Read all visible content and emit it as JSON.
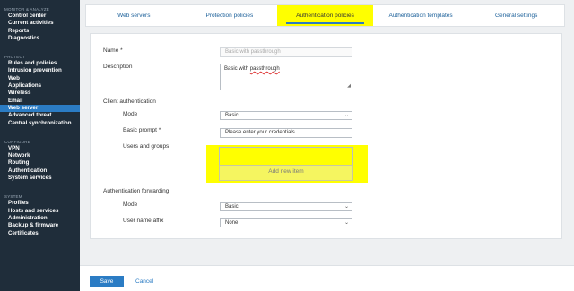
{
  "sidebar": {
    "sections": [
      {
        "title": "MONITOR & ANALYZE",
        "items": [
          "Control center",
          "Current activities",
          "Reports",
          "Diagnostics"
        ]
      },
      {
        "title": "PROTECT",
        "items": [
          "Rules and policies",
          "Intrusion prevention",
          "Web",
          "Applications",
          "Wireless",
          "Email",
          "Web server",
          "Advanced threat",
          "Central synchronization"
        ]
      },
      {
        "title": "CONFIGURE",
        "items": [
          "VPN",
          "Network",
          "Routing",
          "Authentication",
          "System services"
        ]
      },
      {
        "title": "SYSTEM",
        "items": [
          "Profiles",
          "Hosts and services",
          "Administration",
          "Backup & firmware",
          "Certificates"
        ]
      }
    ],
    "active_item": "Web server"
  },
  "tabs": [
    "Web servers",
    "Protection policies",
    "Authentication policies",
    "Authentication templates",
    "General settings"
  ],
  "active_tab": "Authentication policies",
  "form": {
    "name_label": "Name *",
    "name_value": "Basic with passthrough",
    "description_label": "Description",
    "description_value_prefix": "Basic with ",
    "description_value_misspelled": "passthrough",
    "client_auth_heading": "Client authentication",
    "mode_label": "Mode",
    "mode_value": "Basic",
    "basic_prompt_label": "Basic prompt *",
    "basic_prompt_value": "Please enter your credentials.",
    "users_groups_label": "Users and groups",
    "add_new_item": "Add new item",
    "auth_forwarding_heading": "Authentication forwarding",
    "fwd_mode_label": "Mode",
    "fwd_mode_value": "Basic",
    "user_affix_label": "User name affix",
    "user_affix_value": "None"
  },
  "buttons": {
    "save": "Save",
    "cancel": "Cancel"
  },
  "icons": {
    "dropdown": "chevron-down-icon",
    "resize": "resize-handle-icon"
  },
  "colors": {
    "sidebar_bg": "#1f2d3a",
    "accent": "#2b7cc4",
    "highlight": "#ffff00"
  }
}
